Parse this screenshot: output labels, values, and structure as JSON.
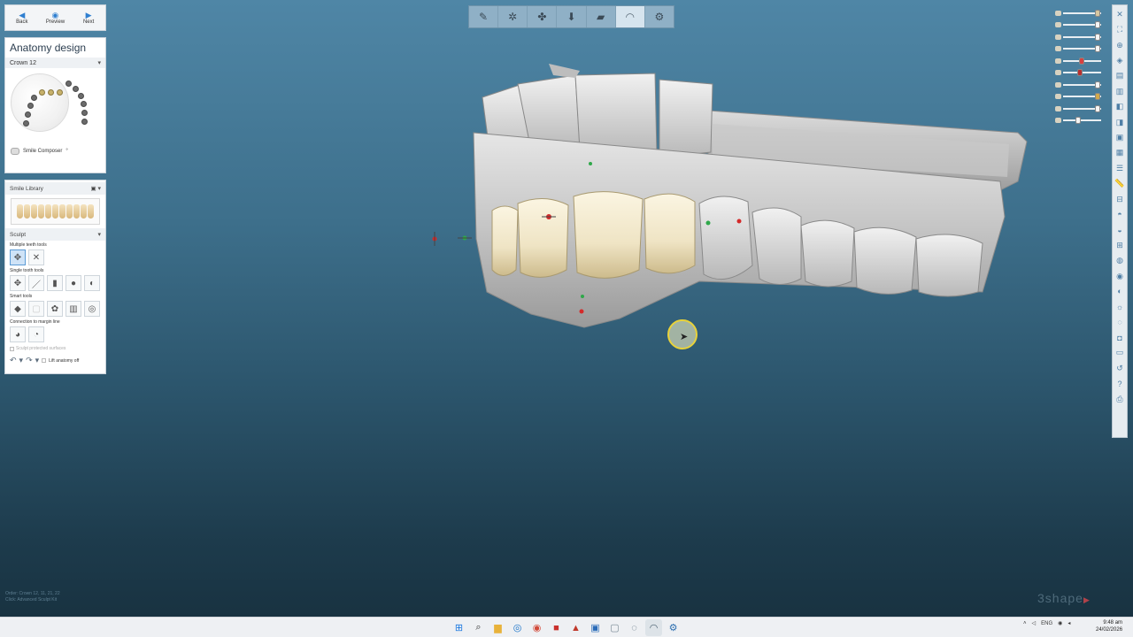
{
  "nav": {
    "back_label": "Back",
    "preview_label": "Preview",
    "next_label": "Next"
  },
  "anatomy": {
    "title": "Anatomy design",
    "selected": "Crown 12",
    "composer_label": "Smile Composer",
    "composer_badge": "°"
  },
  "library": {
    "title": "Smile Library"
  },
  "sculpt": {
    "title": "Sculpt",
    "multiple_label": "Multiple teeth tools",
    "single_label": "Single tooth tools",
    "smart_label": "Smart tools",
    "connection_label": "Connection to margin line",
    "protected_label": "Sculpt protected surfaces",
    "lift_label": "Lift anatomy off"
  },
  "status": {
    "line1": "Order: Crown 12, 11, 21, 22",
    "line2": "Click: Advanced Sculpt Kit"
  },
  "brand": "3shape",
  "tray": {
    "language": "ENG",
    "time": "9:48 am",
    "date": "24/02/2026"
  },
  "colors": {
    "background_top": "#4f86a6",
    "background_bottom": "#17303e",
    "crown": "#efe4c4",
    "model": "#cfcfcf",
    "accent": "#2f7fd0"
  },
  "icons": {
    "top_toolbar": [
      "scalpel-icon",
      "sculpt-icon",
      "tooth-tools-icon",
      "download-icon",
      "fit-icon",
      "crown-icon",
      "settings-tooth-icon"
    ],
    "right_strip": [
      "close-icon",
      "fullscreen-icon",
      "zoom-fit-icon",
      "view-3d-icon",
      "view-front-icon",
      "view-top-icon",
      "view-left-icon",
      "view-right-icon",
      "view-back-icon",
      "view-bottom-icon",
      "layers-icon",
      "ruler-icon",
      "section-icon",
      "tooth-icon",
      "bite-icon",
      "preset-icon",
      "margin-icon",
      "contact-icon",
      "color-icon",
      "light-icon",
      "transparency-icon",
      "camera-icon",
      "snapshot-icon",
      "reset-icon",
      "help-icon",
      "print-icon"
    ]
  }
}
